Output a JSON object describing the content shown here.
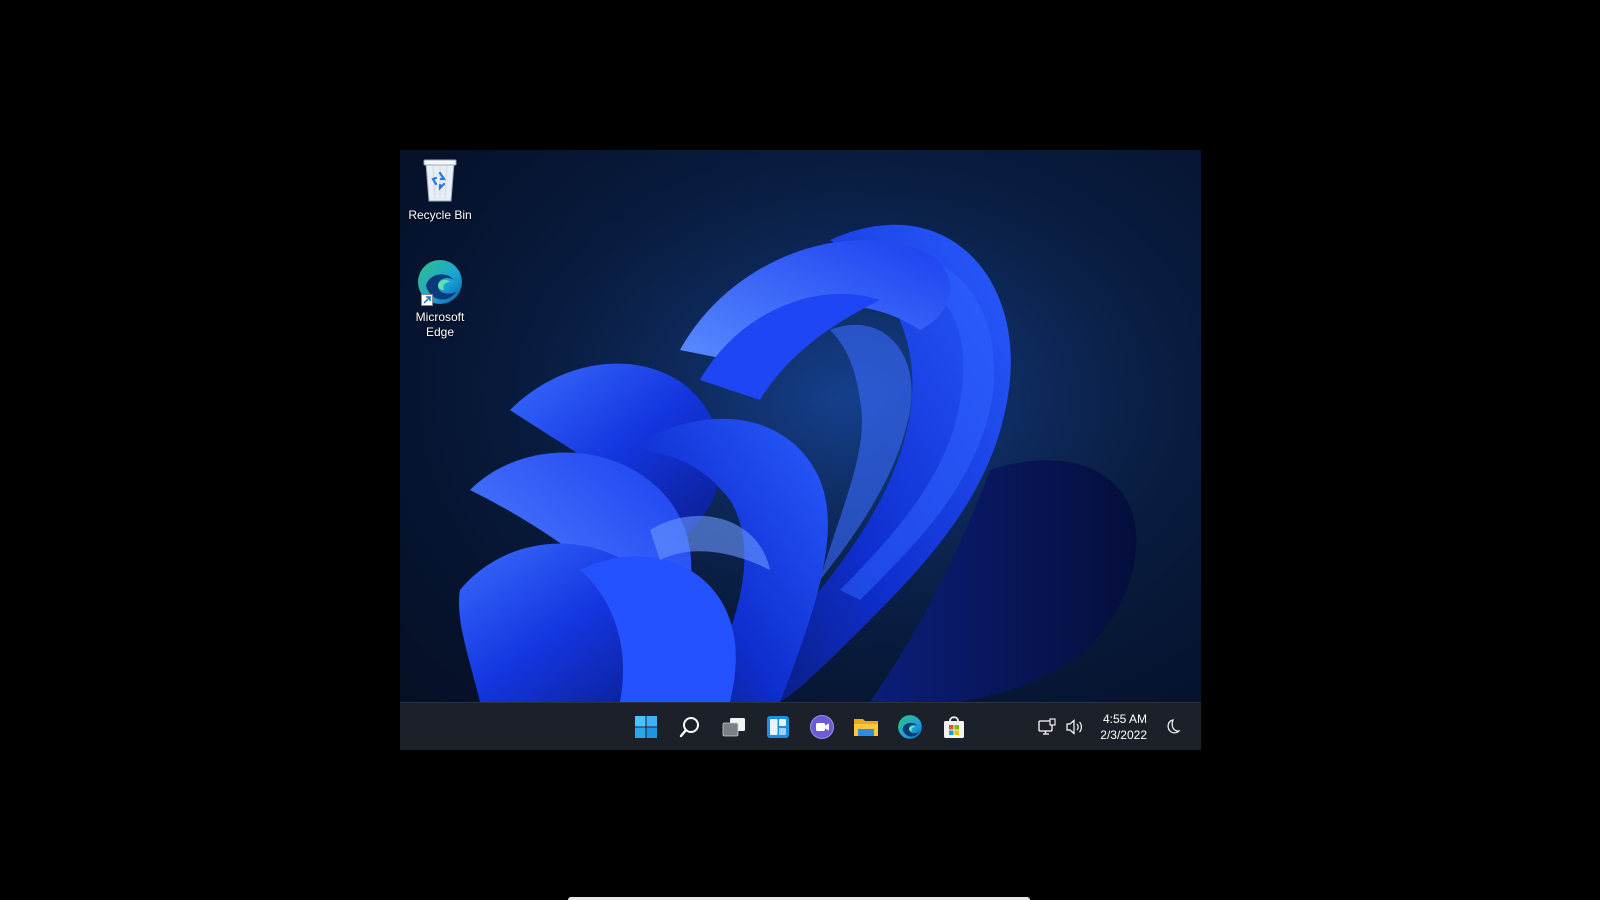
{
  "desktop": {
    "icons": [
      {
        "label": "Recycle Bin",
        "icon": "recycle-bin-icon"
      },
      {
        "label": "Microsoft Edge",
        "icon": "edge-icon"
      }
    ]
  },
  "taskbar": {
    "pinned": [
      {
        "icon": "start-icon"
      },
      {
        "icon": "search-icon"
      },
      {
        "icon": "task-view-icon"
      },
      {
        "icon": "widgets-icon"
      },
      {
        "icon": "teams-chat-icon"
      },
      {
        "icon": "file-explorer-icon"
      },
      {
        "icon": "edge-icon"
      },
      {
        "icon": "microsoft-store-icon"
      }
    ],
    "tray": {
      "time": "4:55 AM",
      "date": "2/3/2022",
      "icons": [
        "network-icon",
        "volume-icon",
        "focus-assist-icon"
      ]
    }
  },
  "colors": {
    "desktop_background": "#0a1f44",
    "taskbar": "#1c2129",
    "bloom_blue": "#1a4bff",
    "accent": "#0078d4"
  }
}
